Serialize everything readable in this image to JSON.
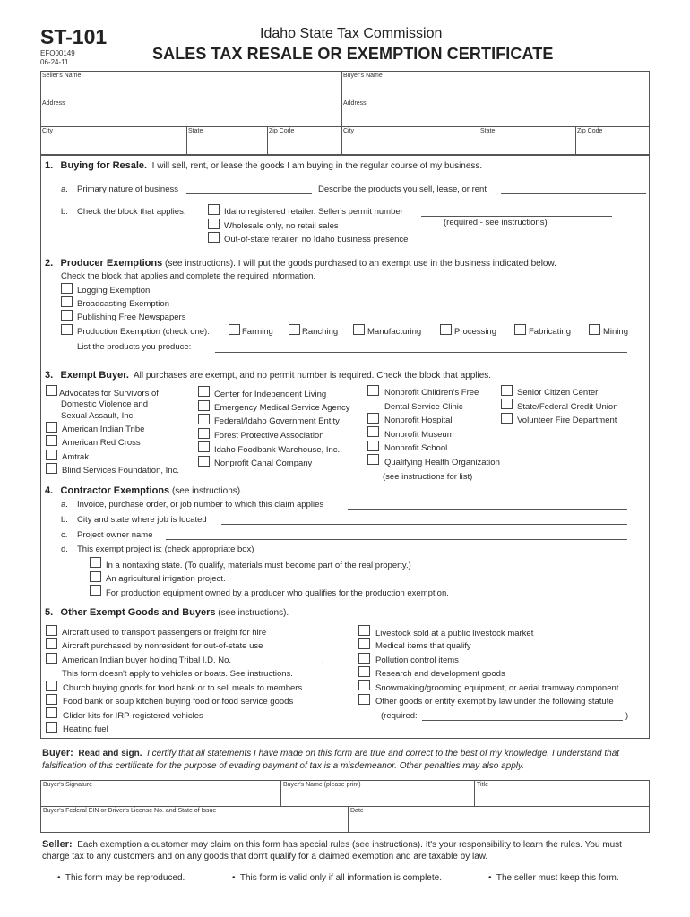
{
  "header": {
    "form_id": "ST-101",
    "form_code": "EFO00149",
    "form_date": "06-24-11",
    "agency": "Idaho State Tax Commission",
    "title": "SALES TAX RESALE OR EXEMPTION CERTIFICATE"
  },
  "parties": {
    "seller_name": "Seller's Name",
    "buyer_name": "Buyer's Name",
    "address": "Address",
    "city": "City",
    "state": "State",
    "zip": "Zip Code"
  },
  "section1": {
    "num": "1.",
    "title": "Buying for Resale.",
    "desc": "I will sell, rent, or lease the goods I am buying in the regular course of my business.",
    "a_letter": "a.",
    "a_label": "Primary nature of business",
    "a_describe": "Describe the products you sell, lease, or rent",
    "b_letter": "b.",
    "b_label": "Check the block that applies:",
    "options": [
      "Idaho registered retailer.  Seller's permit number",
      "Wholesale only, no retail sales",
      "Out-of-state retailer, no Idaho business presence"
    ],
    "permit_note": "(required - see instructions)"
  },
  "section2": {
    "num": "2.",
    "title": "Producer Exemptions",
    "desc": "(see instructions).  I will put the goods purchased to an exempt use in the business indicated below.",
    "instruction": "Check the block that applies and complete the required information.",
    "options": [
      "Logging Exemption",
      "Broadcasting Exemption",
      "Publishing Free Newspapers"
    ],
    "production_label": "Production Exemption (check one):",
    "production_options": [
      "Farming",
      "Ranching",
      "Manufacturing",
      "Processing",
      "Fabricating",
      "Mining"
    ],
    "products_label": "List the products you produce:"
  },
  "section3": {
    "num": "3.",
    "title": "Exempt Buyer.",
    "desc": "All purchases are exempt, and no permit number is required.  Check the block that applies.",
    "col1": [
      "Advocates for Survivors of",
      "Domestic Violence and",
      "Sexual Assault, Inc.",
      "American Indian Tribe",
      "American Red Cross",
      "Amtrak",
      "Blind Services Foundation, Inc."
    ],
    "col2": [
      "Center for Independent Living",
      "Emergency Medical Service Agency",
      "Federal/Idaho Government Entity",
      "Forest Protective Association",
      "Idaho Foodbank Warehouse, Inc.",
      "Nonprofit Canal Company"
    ],
    "col3": [
      "Nonprofit Children's Free",
      "Dental Service Clinic",
      "Nonprofit Hospital",
      "Nonprofit Museum",
      "Nonprofit School",
      "Qualifying Health Organization",
      "(see instructions for list)"
    ],
    "col4": [
      "Senior Citizen Center",
      "State/Federal Credit Union",
      "Volunteer Fire Department"
    ]
  },
  "section4": {
    "num": "4.",
    "title": "Contractor Exemptions",
    "desc": "(see instructions).",
    "a_letter": "a.",
    "a_label": "Invoice, purchase order, or job number to which this claim applies",
    "b_letter": "b.",
    "b_label": "City and state where job is located",
    "c_letter": "c.",
    "c_label": "Project owner name",
    "d_letter": "d.",
    "d_label": "This exempt project is:  (check appropriate box)",
    "options": [
      "In a nontaxing state.  (To qualify, materials must become part of the real property.)",
      "An agricultural irrigation project.",
      "For production equipment owned by a producer who qualifies for the production exemption."
    ]
  },
  "section5": {
    "num": "5.",
    "title": "Other Exempt Goods and Buyers",
    "desc": "(see instructions).",
    "left": [
      "Aircraft used to transport passengers or freight for hire",
      "Aircraft purchased by nonresident for out-of-state use",
      "American Indian buyer holding Tribal I.D. No.",
      "This form doesn't apply to vehicles or boats.  See instructions.",
      "Church buying goods for food bank or to sell meals to members",
      "Food bank or soup kitchen buying food or food service goods",
      "Glider kits for IRP-registered vehicles",
      "Heating fuel"
    ],
    "right": [
      "Livestock sold at a public livestock market",
      "Medical items that qualify",
      "Pollution control items",
      "Research and development goods",
      "Snowmaking/grooming equipment, or aerial tramway component",
      "Other goods or entity exempt by law under the following statute"
    ],
    "required_open": "(required:",
    "required_close": ")"
  },
  "buyer": {
    "label": "Buyer:",
    "read_sign": "Read and sign.",
    "cert_line1": "I certify that all statements I have made on this form are true and correct to the best of my knowledge.  I understand that",
    "cert_line2": "falsification of this certificate for the purpose of evading payment of tax is a misdemeanor.  Other penalties may also apply.",
    "signature": "Buyer's Signature",
    "name_print": "Buyer's Name (please print)",
    "title_field": "Title",
    "ein": "Buyer's Federal EIN or Driver's License No. and State of Issue",
    "date": "Date"
  },
  "seller": {
    "label": "Seller:",
    "line1": "Each exemption a customer may claim on this form has special rules (see instructions).  It's your responsibility to learn the rules.  You must",
    "line2": "charge tax to any customers and on any goods that don't qualify for a claimed exemption and are taxable by law.",
    "bullets": [
      "This form may be reproduced.",
      "This form is valid only if all information is complete.",
      "The seller must keep this form."
    ]
  }
}
